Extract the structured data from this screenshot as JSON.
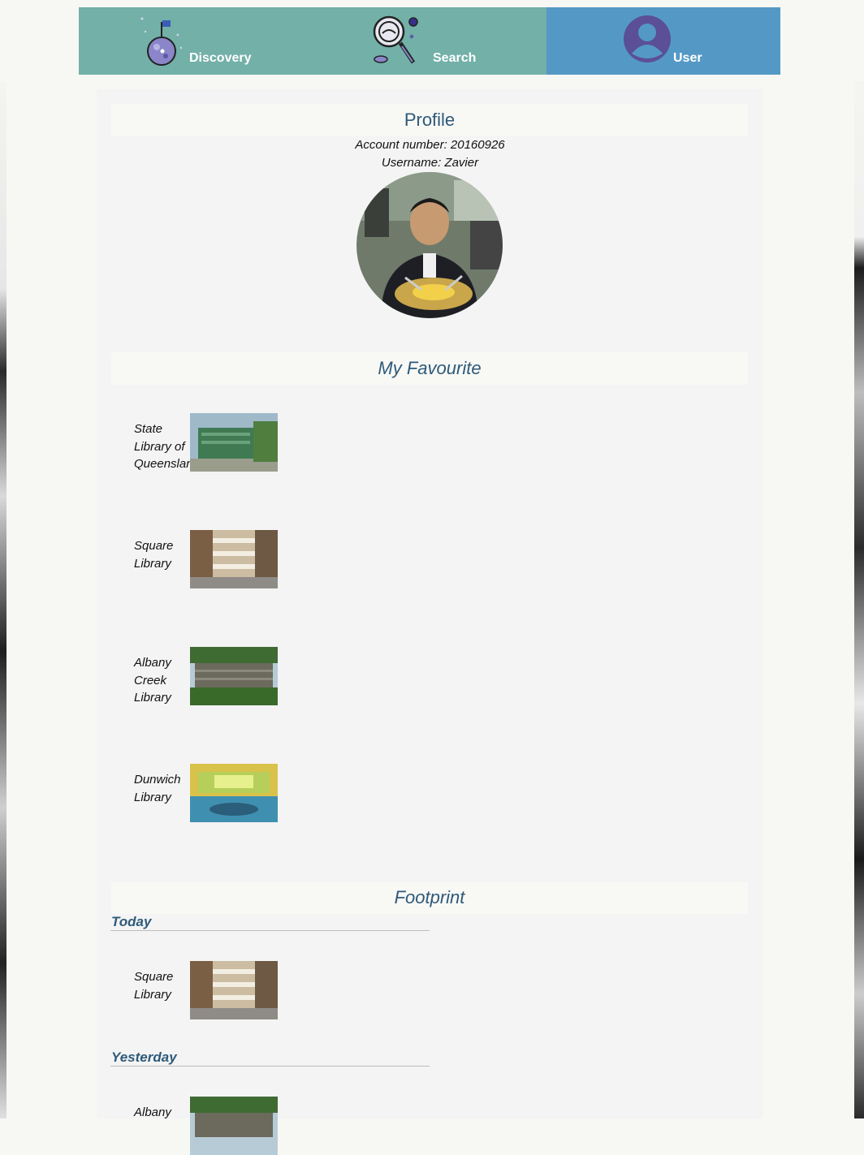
{
  "nav": {
    "items": [
      {
        "label": "Discovery",
        "icon": "planet-flag-icon"
      },
      {
        "label": "Search",
        "icon": "magnifier-space-icon"
      },
      {
        "label": "User",
        "icon": "user-avatar-icon"
      }
    ],
    "active": "User",
    "colors": {
      "inactive": "#72b0a8",
      "active": "#5499c5"
    }
  },
  "profile": {
    "title": "Profile",
    "account_line": "Account number: 20160926",
    "username_line": "Username: Zavier",
    "avatar_alt": "photo"
  },
  "favourites": {
    "title": "My Favourite",
    "items": [
      {
        "name": "State Library of Queensland"
      },
      {
        "name": "Square Library"
      },
      {
        "name": "Albany Creek Library"
      },
      {
        "name": "Dunwich Library"
      }
    ]
  },
  "footprint": {
    "title": "Footprint",
    "groups": [
      {
        "label": "Today",
        "items": [
          {
            "name": "Square Library"
          }
        ]
      },
      {
        "label": "Yesterday",
        "items": [
          {
            "name": "Albany"
          }
        ]
      }
    ]
  }
}
